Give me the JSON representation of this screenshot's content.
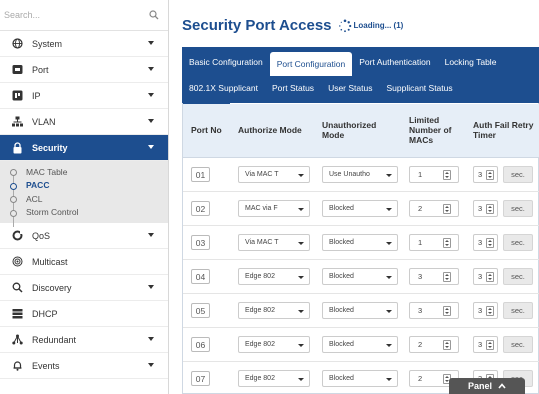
{
  "search": {
    "placeholder": "Search..."
  },
  "sidebar": {
    "items": [
      {
        "label": "System",
        "icon": "globe-icon"
      },
      {
        "label": "Port",
        "icon": "port-icon"
      },
      {
        "label": "IP",
        "icon": "ip-icon"
      },
      {
        "label": "VLAN",
        "icon": "vlan-icon"
      },
      {
        "label": "Security",
        "icon": "lock-icon"
      },
      {
        "label": "QoS",
        "icon": "qos-icon"
      },
      {
        "label": "Multicast",
        "icon": "multicast-icon"
      },
      {
        "label": "Discovery",
        "icon": "search-icon"
      },
      {
        "label": "DHCP",
        "icon": "server-icon"
      },
      {
        "label": "Redundant",
        "icon": "network-icon"
      },
      {
        "label": "Events",
        "icon": "bell-icon"
      }
    ],
    "security_sub": [
      "MAC Table",
      "PACC",
      "ACL",
      "Storm Control"
    ]
  },
  "page": {
    "title": "Security Port Access",
    "loading": "Loading... (1)"
  },
  "tabs": {
    "row1": [
      "Basic Configuration",
      "Port Configuration",
      "Port Authentication",
      "Locking Table"
    ],
    "row2": [
      "802.1X Supplicant",
      "Port Status",
      "User Status",
      "Supplicant Status"
    ],
    "active": "Port Configuration"
  },
  "table": {
    "headers": [
      "Port No",
      "Authorize Mode",
      "Unauthorized Mode",
      "Limited Number of MACs",
      "Auth Fail Retry Timer"
    ],
    "sec_label": "sec.",
    "rows": [
      {
        "port": "01",
        "auth": "Via MAC T",
        "unauth": "Use Unautho",
        "macs": "1",
        "retry": "3"
      },
      {
        "port": "02",
        "auth": "MAC via F",
        "unauth": "Blocked",
        "macs": "2",
        "retry": "3"
      },
      {
        "port": "03",
        "auth": "Via MAC T",
        "unauth": "Blocked",
        "macs": "1",
        "retry": "3"
      },
      {
        "port": "04",
        "auth": "Edge 802",
        "unauth": "Blocked",
        "macs": "3",
        "retry": "3"
      },
      {
        "port": "05",
        "auth": "Edge 802",
        "unauth": "Blocked",
        "macs": "3",
        "retry": "3"
      },
      {
        "port": "06",
        "auth": "Edge 802",
        "unauth": "Blocked",
        "macs": "2",
        "retry": "3"
      },
      {
        "port": "07",
        "auth": "Edge 802",
        "unauth": "Blocked",
        "macs": "2",
        "retry": "3"
      }
    ]
  },
  "panel": {
    "label": "Panel"
  },
  "colors": {
    "brand": "#1d4e8f",
    "header_bg": "#e6eef7",
    "submenu_bg": "#e8e8e8"
  }
}
